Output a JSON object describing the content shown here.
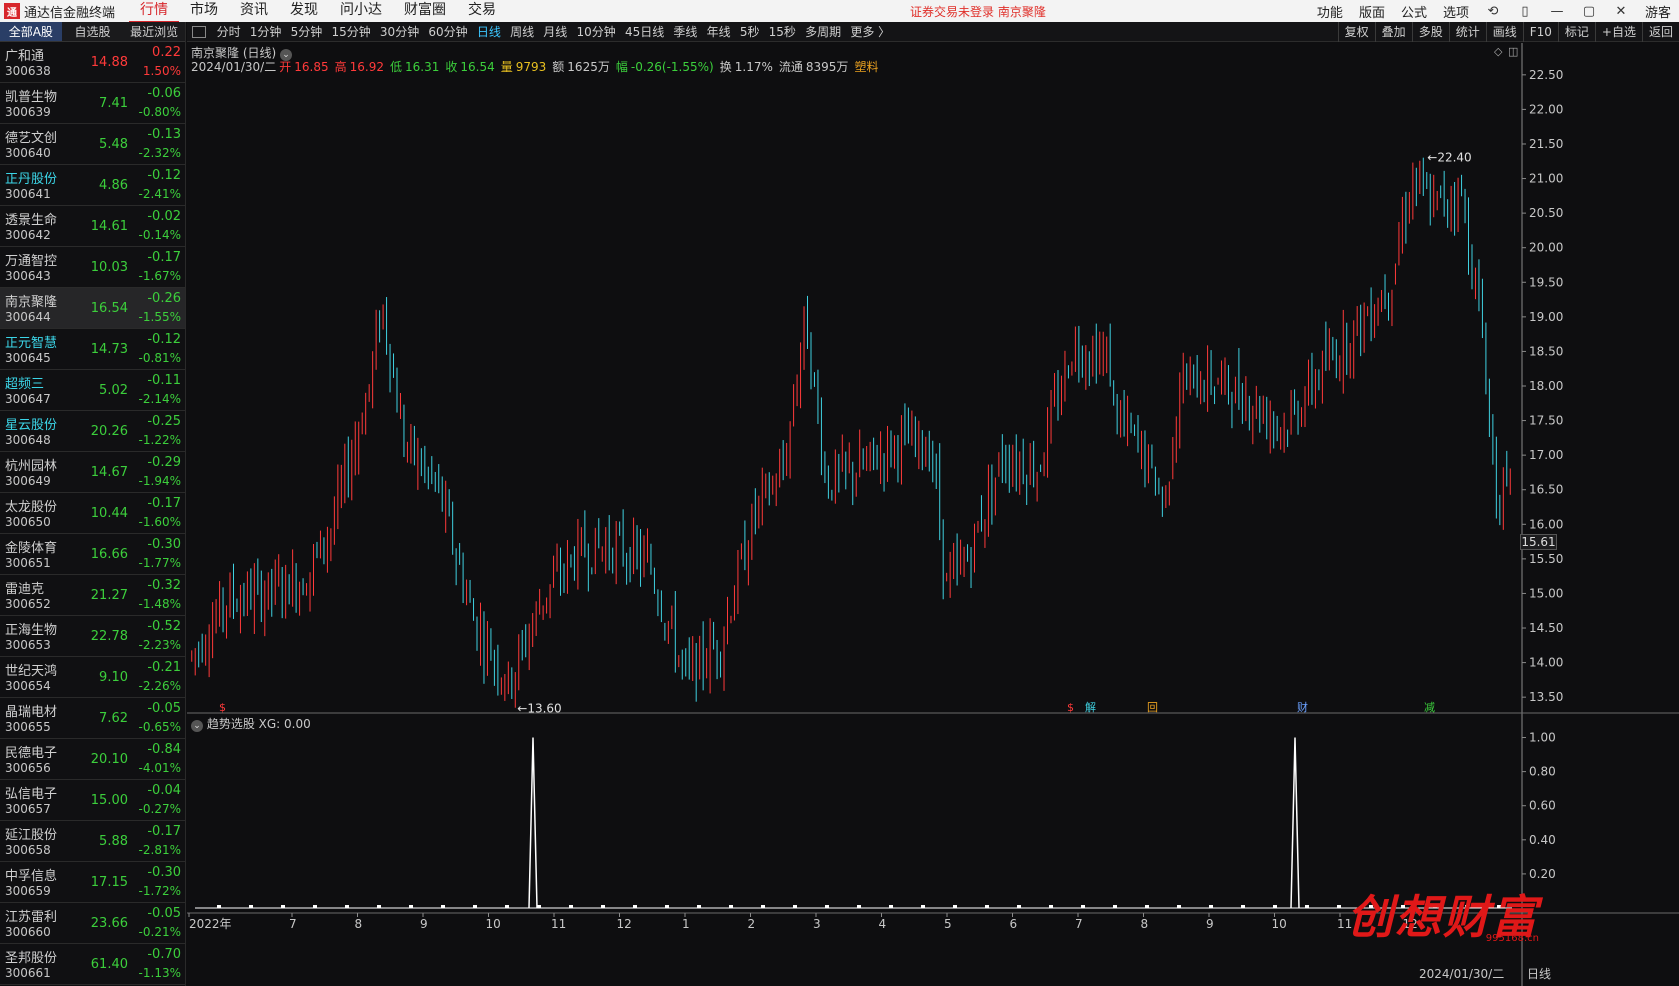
{
  "topbar": {
    "app_title": "通达信金融终端",
    "menu": [
      "行情",
      "市场",
      "资讯",
      "发现",
      "问小达",
      "财富圈",
      "交易"
    ],
    "notice": "证券交易未登录  南京聚隆",
    "right_menu": [
      "功能",
      "版面",
      "公式",
      "选项"
    ],
    "user": "游客"
  },
  "left": {
    "tabs": [
      "全部A股",
      "自选股",
      "最近浏览"
    ],
    "stocks": [
      {
        "name": "广和通",
        "code": "300638",
        "price": "14.88",
        "change": "0.22",
        "pct": "1.50%",
        "dir": "up",
        "cyan": false
      },
      {
        "name": "凯普生物",
        "code": "300639",
        "price": "7.41",
        "change": "-0.06",
        "pct": "-0.80%",
        "dir": "dn",
        "cyan": false
      },
      {
        "name": "德艺文创",
        "code": "300640",
        "price": "5.48",
        "change": "-0.13",
        "pct": "-2.32%",
        "dir": "dn",
        "cyan": false
      },
      {
        "name": "正丹股份",
        "code": "300641",
        "price": "4.86",
        "change": "-0.12",
        "pct": "-2.41%",
        "dir": "dn",
        "cyan": true
      },
      {
        "name": "透景生命",
        "code": "300642",
        "price": "14.61",
        "change": "-0.02",
        "pct": "-0.14%",
        "dir": "dn",
        "cyan": false
      },
      {
        "name": "万通智控",
        "code": "300643",
        "price": "10.03",
        "change": "-0.17",
        "pct": "-1.67%",
        "dir": "dn",
        "cyan": false
      },
      {
        "name": "南京聚隆",
        "code": "300644",
        "price": "16.54",
        "change": "-0.26",
        "pct": "-1.55%",
        "dir": "dn",
        "cyan": false,
        "selected": true
      },
      {
        "name": "正元智慧",
        "code": "300645",
        "price": "14.73",
        "change": "-0.12",
        "pct": "-0.81%",
        "dir": "dn",
        "cyan": true
      },
      {
        "name": "超频三",
        "code": "300647",
        "price": "5.02",
        "change": "-0.11",
        "pct": "-2.14%",
        "dir": "dn",
        "cyan": true
      },
      {
        "name": "星云股份",
        "code": "300648",
        "price": "20.26",
        "change": "-0.25",
        "pct": "-1.22%",
        "dir": "dn",
        "cyan": true
      },
      {
        "name": "杭州园林",
        "code": "300649",
        "price": "14.67",
        "change": "-0.29",
        "pct": "-1.94%",
        "dir": "dn",
        "cyan": false
      },
      {
        "name": "太龙股份",
        "code": "300650",
        "price": "10.44",
        "change": "-0.17",
        "pct": "-1.60%",
        "dir": "dn",
        "cyan": false
      },
      {
        "name": "金陵体育",
        "code": "300651",
        "price": "16.66",
        "change": "-0.30",
        "pct": "-1.77%",
        "dir": "dn",
        "cyan": false
      },
      {
        "name": "雷迪克",
        "code": "300652",
        "price": "21.27",
        "change": "-0.32",
        "pct": "-1.48%",
        "dir": "dn",
        "cyan": false
      },
      {
        "name": "正海生物",
        "code": "300653",
        "price": "22.78",
        "change": "-0.52",
        "pct": "-2.23%",
        "dir": "dn",
        "cyan": false
      },
      {
        "name": "世纪天鸿",
        "code": "300654",
        "price": "9.10",
        "change": "-0.21",
        "pct": "-2.26%",
        "dir": "dn",
        "cyan": false
      },
      {
        "name": "晶瑞电材",
        "code": "300655",
        "price": "7.62",
        "change": "-0.05",
        "pct": "-0.65%",
        "dir": "dn",
        "cyan": false
      },
      {
        "name": "民德电子",
        "code": "300656",
        "price": "20.10",
        "change": "-0.84",
        "pct": "-4.01%",
        "dir": "dn",
        "cyan": false
      },
      {
        "name": "弘信电子",
        "code": "300657",
        "price": "15.00",
        "change": "-0.04",
        "pct": "-0.27%",
        "dir": "dn",
        "cyan": false
      },
      {
        "name": "延江股份",
        "code": "300658",
        "price": "5.88",
        "change": "-0.17",
        "pct": "-2.81%",
        "dir": "dn",
        "cyan": false
      },
      {
        "name": "中孚信息",
        "code": "300659",
        "price": "17.15",
        "change": "-0.30",
        "pct": "-1.72%",
        "dir": "dn",
        "cyan": false
      },
      {
        "name": "江苏雷利",
        "code": "300660",
        "price": "23.66",
        "change": "-0.05",
        "pct": "-0.21%",
        "dir": "dn",
        "cyan": false
      },
      {
        "name": "圣邦股份",
        "code": "300661",
        "price": "61.40",
        "change": "-0.70",
        "pct": "-1.13%",
        "dir": "dn",
        "cyan": false
      }
    ]
  },
  "periodbar": {
    "items": [
      "分时",
      "1分钟",
      "5分钟",
      "15分钟",
      "30分钟",
      "60分钟",
      "日线",
      "周线",
      "月线",
      "10分钟",
      "45日线",
      "季线",
      "年线",
      "5秒",
      "15秒",
      "多周期",
      "更多 〉"
    ],
    "active": "日线",
    "right_tools": [
      "复权",
      "叠加",
      "多股",
      "统计",
      "画线",
      "F10",
      "标记",
      "+自选",
      "返回"
    ]
  },
  "chart_info": {
    "title": "南京聚隆 (日线)",
    "date": "2024/01/30/二",
    "open_label": "开",
    "open": "16.85",
    "high_label": "高",
    "high": "16.92",
    "low_label": "低",
    "low": "16.31",
    "close_label": "收",
    "close": "16.54",
    "vol_label": "量",
    "vol": "9793",
    "amt_label": "额",
    "amt": "1625万",
    "chg_label": "幅",
    "chg": "-0.26(-1.55%)",
    "turn_label": "换",
    "turn": "1.17%",
    "float_label": "流通",
    "float": "8395万",
    "sector": "塑料",
    "last_price": "15.61",
    "max_label": "22.40",
    "min_label": "13.60",
    "indicator_label": "趋势选股  XG: 0.00",
    "end_date": "2024/01/30/二",
    "daily_tag": "日线",
    "watermark": "创想财富",
    "watermark_url": "995168.cn",
    "markers": [
      "$",
      "$",
      "解",
      "回",
      "财",
      "减"
    ]
  },
  "chart_data": {
    "type": "candlestick",
    "yaxis_labels": [
      "22.50",
      "22.00",
      "21.50",
      "21.00",
      "20.50",
      "20.00",
      "19.50",
      "19.00",
      "18.50",
      "18.00",
      "17.50",
      "17.00",
      "16.50",
      "16.00",
      "15.50",
      "15.00",
      "14.50",
      "14.00",
      "13.50"
    ],
    "ylim": [
      13.3,
      22.7
    ],
    "xaxis_labels": [
      "2022年",
      "7",
      "8",
      "9",
      "10",
      "11",
      "12",
      "1",
      "2",
      "3",
      "4",
      "5",
      "6",
      "7",
      "8",
      "9",
      "10",
      "11",
      "12"
    ],
    "indicator": {
      "name": "XG",
      "ylabels": [
        "1.00",
        "0.80",
        "0.60",
        "0.40",
        "0.20"
      ],
      "ylim": [
        0,
        1.05
      ],
      "signals_at_month": [
        "10",
        "10"
      ]
    },
    "keypoints": [
      {
        "m": 0,
        "p": 14.1
      },
      {
        "m": 0.5,
        "p": 14.9
      },
      {
        "m": 1,
        "p": 15.0
      },
      {
        "m": 1.6,
        "p": 15.2
      },
      {
        "m": 2,
        "p": 16.0
      },
      {
        "m": 2.5,
        "p": 17.9
      },
      {
        "m": 2.7,
        "p": 19.2
      },
      {
        "m": 3,
        "p": 17.2
      },
      {
        "m": 3.5,
        "p": 16.5
      },
      {
        "m": 4,
        "p": 14.6
      },
      {
        "m": 4.5,
        "p": 13.7
      },
      {
        "m": 5,
        "p": 15.0
      },
      {
        "m": 5.5,
        "p": 15.6
      },
      {
        "m": 6,
        "p": 15.7
      },
      {
        "m": 6.5,
        "p": 15.4
      },
      {
        "m": 7,
        "p": 13.8
      },
      {
        "m": 7.5,
        "p": 14.3
      },
      {
        "m": 8,
        "p": 16.2
      },
      {
        "m": 8.4,
        "p": 16.8
      },
      {
        "m": 8.7,
        "p": 19.0
      },
      {
        "m": 9,
        "p": 16.6
      },
      {
        "m": 9.5,
        "p": 16.8
      },
      {
        "m": 10,
        "p": 17.2
      },
      {
        "m": 10.5,
        "p": 17.1
      },
      {
        "m": 10.7,
        "p": 15.1
      },
      {
        "m": 11,
        "p": 15.5
      },
      {
        "m": 11.5,
        "p": 17.0
      },
      {
        "m": 12,
        "p": 16.8
      },
      {
        "m": 12.5,
        "p": 18.6
      },
      {
        "m": 13,
        "p": 18.4
      },
      {
        "m": 13.1,
        "p": 17.6
      },
      {
        "m": 13.5,
        "p": 17.0
      },
      {
        "m": 13.8,
        "p": 16.3
      },
      {
        "m": 14,
        "p": 18.0
      },
      {
        "m": 14.5,
        "p": 18.1
      },
      {
        "m": 15,
        "p": 17.8
      },
      {
        "m": 15.5,
        "p": 17.4
      },
      {
        "m": 16,
        "p": 18.2
      },
      {
        "m": 16.5,
        "p": 18.8
      },
      {
        "m": 17,
        "p": 19.5
      },
      {
        "m": 17.3,
        "p": 21.0
      },
      {
        "m": 17.6,
        "p": 20.6
      },
      {
        "m": 18,
        "p": 20.8
      },
      {
        "m": 18.3,
        "p": 18.8
      },
      {
        "m": 18.5,
        "p": 16.4
      },
      {
        "m": 18.7,
        "p": 16.5
      }
    ]
  }
}
